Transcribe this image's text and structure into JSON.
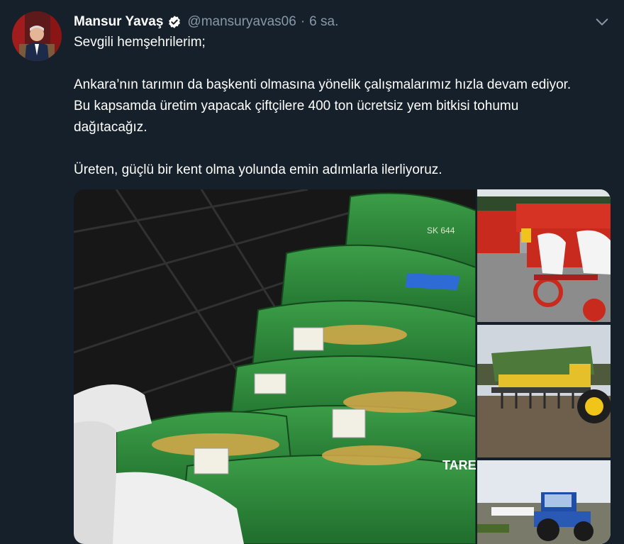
{
  "tweet": {
    "author_name": "Mansur Yavaş",
    "handle": "@mansuryavas06",
    "separator": "·",
    "time": "6 sa.",
    "paragraphs": [
      "Sevgili hemşehrilerim;",
      "Ankara’nın tarımın da başkenti olmasına yönelik çalışmalarımız hızla devam ediyor. Bu kapsamda üretim yapacak çiftçilere 400 ton ücretsiz yem bitkisi tohumu dağıtacağız.",
      "Üreten, güçlü bir kent olma yolunda emin adımlarla ilerliyoruz."
    ]
  },
  "icons": {
    "verified": "verified-badge-icon",
    "caret": "chevron-down-icon"
  },
  "media_labels": {
    "bag_brand": "TAREY",
    "bag_code": "SK 644"
  },
  "colors": {
    "background": "#15202b",
    "secondary_text": "#8899a6",
    "accent_bag_green": "#2f8a3c",
    "machine_red": "#c92a1e"
  }
}
